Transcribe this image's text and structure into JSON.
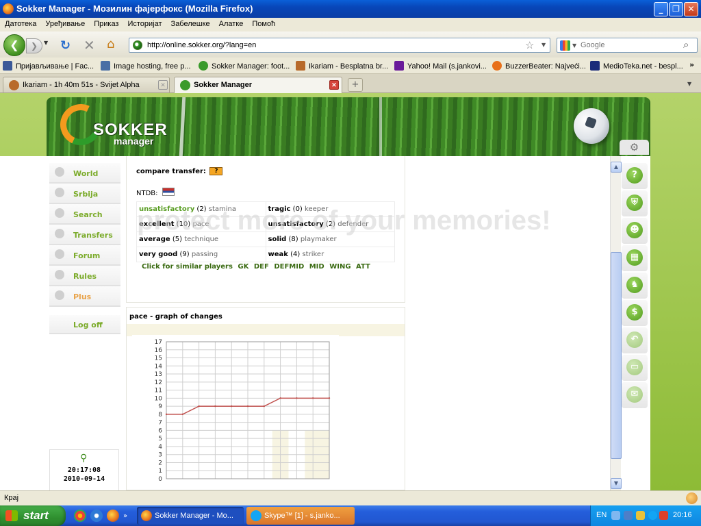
{
  "window": {
    "title": "Sokker Manager - Мозилин фајерфокс (Mozilla Firefox)",
    "minimize": "_",
    "maximize": "❐",
    "close": "✕"
  },
  "menu": [
    "Датотека",
    "Уређивање",
    "Приказ",
    "Историјат",
    "Забелешке",
    "Алатке",
    "Помоћ"
  ],
  "nav": {
    "url": "http://online.sokker.org/?lang=en",
    "search_placeholder": "Google"
  },
  "bookmarks": [
    {
      "label": "Пријављивање | Fac...",
      "color": "#3b5998"
    },
    {
      "label": "Image hosting, free p...",
      "color": "#4a6fa5"
    },
    {
      "label": "Sokker Manager: foot...",
      "color": "#3a9a2a"
    },
    {
      "label": "Ikariam - Besplatna br...",
      "color": "#b86a2a"
    },
    {
      "label": "Yahoo! Mail (s.jankovi...",
      "color": "#6a1b9a"
    },
    {
      "label": "BuzzerBeater: Najveći...",
      "color": "#e8701a"
    },
    {
      "label": "MedioTeka.net - bespl...",
      "color": "#1c2c7a"
    }
  ],
  "bookmarks_more": "»",
  "tabs": [
    {
      "label": "Ikariam - 1h 40m 51s - Svijet Alpha",
      "active": false
    },
    {
      "label": "Sokker Manager",
      "active": true
    }
  ],
  "new_tab": "+",
  "logo": {
    "word": "SOKKER",
    "sub": "manager"
  },
  "left_menu": [
    {
      "label": "World"
    },
    {
      "label": "Srbija"
    },
    {
      "label": "Search"
    },
    {
      "label": "Transfers"
    },
    {
      "label": "Forum"
    },
    {
      "label": "Rules"
    },
    {
      "label": "Plus"
    }
  ],
  "logoff": "Log off",
  "clock": {
    "time": "20:17:08",
    "date": "2010-09-14"
  },
  "player": {
    "compare_label": "compare transfer:",
    "compare_badge": "?",
    "ntdb_label": "NTDB:",
    "skills": [
      [
        {
          "level": "unsatisfactory",
          "value": "(2)",
          "skill": "stamina",
          "green": true
        },
        {
          "level": "tragic",
          "value": "(0)",
          "skill": "keeper",
          "green": false
        }
      ],
      [
        {
          "level": "excellent",
          "value": "(10)",
          "skill": "pace",
          "green": false
        },
        {
          "level": "unsatisfactory",
          "value": "(2)",
          "skill": "defender",
          "green": false
        }
      ],
      [
        {
          "level": "average",
          "value": "(5)",
          "skill": "technique",
          "green": false
        },
        {
          "level": "solid",
          "value": "(8)",
          "skill": "playmaker",
          "green": false
        }
      ],
      [
        {
          "level": "very good",
          "value": "(9)",
          "skill": "passing",
          "green": false
        },
        {
          "level": "weak",
          "value": "(4)",
          "skill": "striker",
          "green": false
        }
      ]
    ],
    "similar_label": "Click for similar players",
    "similar_links": [
      "GK",
      "DEF",
      "DEFMID",
      "MID",
      "WING",
      "ATT"
    ]
  },
  "graph": {
    "title": "pace - graph of changes"
  },
  "chart_data": {
    "type": "line",
    "title": "",
    "xlabel": "",
    "ylabel": "",
    "y_ticks": [
      0,
      1,
      2,
      3,
      4,
      5,
      6,
      7,
      8,
      9,
      10,
      11,
      12,
      13,
      14,
      15,
      16,
      17
    ],
    "ylim": [
      0,
      17
    ],
    "x": [
      0,
      1,
      2,
      3,
      4,
      5,
      6,
      7,
      8,
      9,
      10
    ],
    "series": [
      {
        "values": [
          8,
          8,
          9,
          9,
          9,
          9,
          9,
          10,
          10,
          10,
          10
        ],
        "color": "#c0504d"
      }
    ],
    "grid": true
  },
  "right_icons": [
    {
      "name": "help-icon",
      "glyph": "?"
    },
    {
      "name": "shield-icon",
      "glyph": "⛨"
    },
    {
      "name": "player-icon",
      "glyph": "☻"
    },
    {
      "name": "tactics-icon",
      "glyph": "▦"
    },
    {
      "name": "training-icon",
      "glyph": "♞"
    },
    {
      "name": "money-icon",
      "glyph": "$"
    },
    {
      "name": "undo-icon",
      "glyph": "↶"
    },
    {
      "name": "ticket-icon",
      "glyph": "▭"
    },
    {
      "name": "mail-icon",
      "glyph": "✉"
    }
  ],
  "status": {
    "text": "Крај"
  },
  "taskbar": {
    "start": "start",
    "tasks": [
      {
        "label": "Sokker Manager - Mo...",
        "color": "#e8701a"
      },
      {
        "label": "Skype™ [1] - s.janko...",
        "color": "#12a5f4"
      }
    ],
    "lang": "EN",
    "clock": "20:16"
  }
}
